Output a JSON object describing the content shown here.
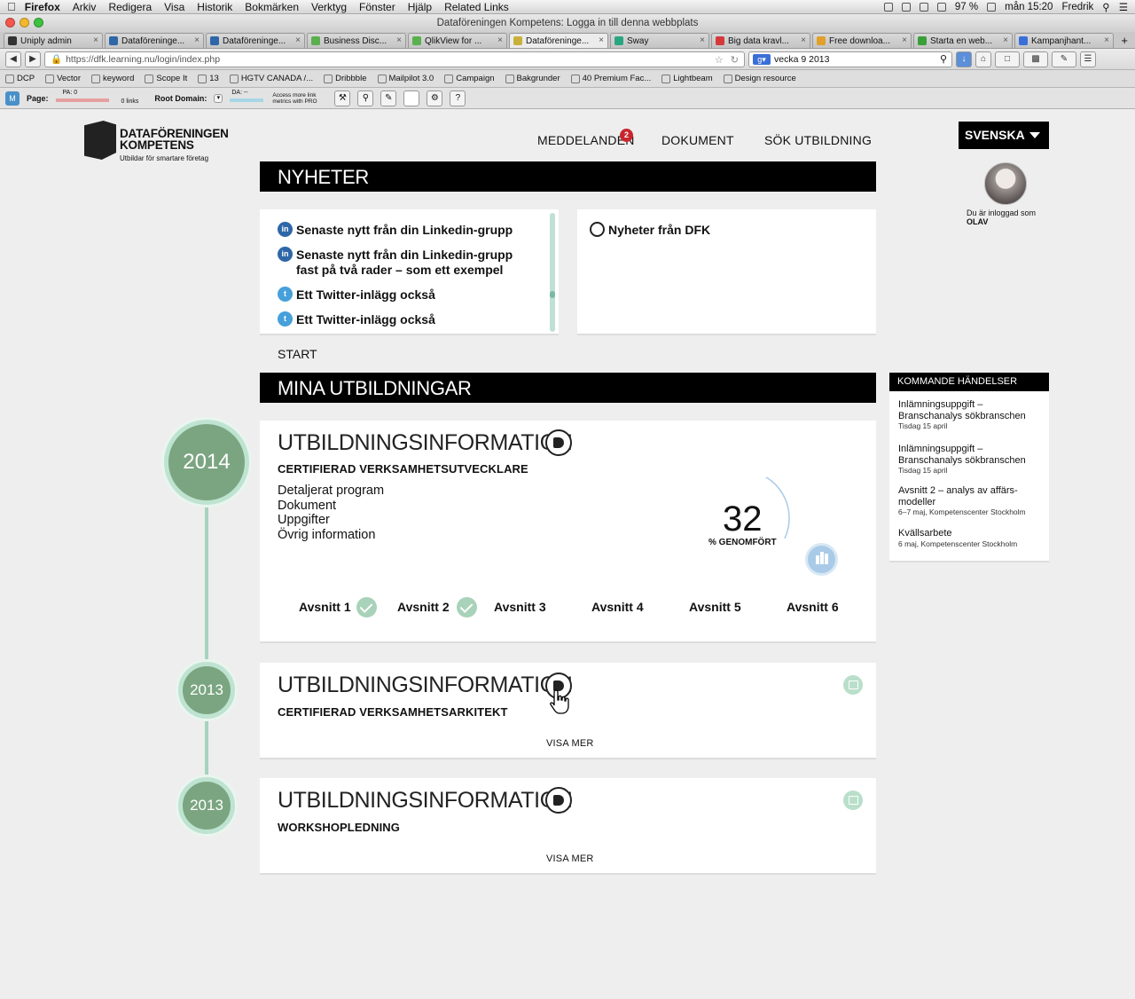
{
  "os_menu": {
    "app": "Firefox",
    "items": [
      "Arkiv",
      "Redigera",
      "Visa",
      "Historik",
      "Bokmärken",
      "Verktyg",
      "Fönster",
      "Hjälp",
      "Related Links"
    ],
    "battery": "97 %",
    "clock": "mån 15:20",
    "user": "Fredrik"
  },
  "window_title": "Dataföreningen Kompetens: Logga in till denna webbplats",
  "tabs": [
    {
      "label": "Uniply admin",
      "color": "#333"
    },
    {
      "label": "Dataföreninge...",
      "color": "#2e67a8"
    },
    {
      "label": "Dataföreninge...",
      "color": "#2e67a8"
    },
    {
      "label": "Business Disc...",
      "color": "#5ab04e"
    },
    {
      "label": "QlikView for ...",
      "color": "#5ab04e"
    },
    {
      "label": "Dataföreninge...",
      "color": "#c9b03a",
      "active": true
    },
    {
      "label": "Sway",
      "color": "#29a67f"
    },
    {
      "label": "Big data kravl...",
      "color": "#d43a3a"
    },
    {
      "label": "Free downloa...",
      "color": "#e0a02a"
    },
    {
      "label": "Starta en web...",
      "color": "#3a9e3a"
    },
    {
      "label": "Kampanjhant...",
      "color": "#3a6fd8"
    }
  ],
  "urlbar": {
    "url": "https://dfk.learning.nu/login/index.php",
    "search_value": "vecka 9 2013"
  },
  "bookmarks": [
    "DCP",
    "Vector",
    "keyword",
    "Scope It",
    "13",
    "HGTV CANADA /...",
    "Dribbble",
    "Mailpilot 3.0",
    "Campaign",
    "Bakgrunder",
    "40 Premium Fac...",
    "Lightbeam",
    "Design resource"
  ],
  "seo": {
    "page_label": "Page:",
    "pa": "PA: 0",
    "links": "0 links",
    "root_label": "Root Domain:",
    "da": "DA: --",
    "pro": "Access more link metrics with PRO"
  },
  "logo": {
    "line1": "DATAFÖRENINGEN",
    "line2": "KOMPETENS",
    "tagline": "Utbildar för smartare företag"
  },
  "nav": {
    "messages": "MEDDELANDEN",
    "messages_count": "2",
    "documents": "DOKUMENT",
    "search": "SÖK UTBILDNING"
  },
  "language": "SVENSKA",
  "user": {
    "logged_in_label": "Du är inloggad som",
    "name": "OLAV"
  },
  "news": {
    "header": "NYHETER",
    "items": [
      "Senaste nytt från din Linkedin-grupp",
      "Senaste nytt från din Linkedin-grupp fast på två rader – som ett exempel",
      "Ett Twitter-inlägg också",
      "Ett Twitter-inlägg också"
    ],
    "dfk_title": "Nyheter från DFK"
  },
  "breadcrumb": "START",
  "courses_header": "MINA UTBILDNINGAR",
  "courses": [
    {
      "year": "2014",
      "title": "UTBILDNINGSINFORMATION",
      "program": "CERTIFIERAD VERKSAMHETSUTVECKLARE",
      "links": [
        "Detaljerat program",
        "Dokument",
        "Uppgifter",
        "Övrig information"
      ],
      "progress": "32",
      "progress_label": "% GENOMFÖRT",
      "sections": [
        "Avsnitt 1",
        "Avsnitt 2",
        "Avsnitt 3",
        "Avsnitt 4",
        "Avsnitt 5",
        "Avsnitt 6"
      ]
    },
    {
      "year": "2013",
      "title": "UTBILDNINGSINFORMATION",
      "program": "CERTIFIERAD VERKSAMHETSARKITEKT",
      "more": "VISA MER"
    },
    {
      "year": "2013",
      "title": "UTBILDNINGSINFORMATION",
      "program": "WORKSHOPLEDNING",
      "more": "VISA MER"
    }
  ],
  "events": {
    "header": "KOMMANDE HÄNDELSER",
    "items": [
      {
        "title": "Inlämningsuppgift – Branschanalys sökbranschen",
        "when": "Tisdag 15 april"
      },
      {
        "title": "Inlämningsuppgift – Branschanalys sökbranschen",
        "when": "Tisdag 15 april"
      },
      {
        "title": "Avsnitt 2 – analys av affärs-modeller",
        "when": "6–7 maj, Kompetenscenter Stockholm"
      },
      {
        "title": "Kvällsarbete",
        "when": "6 maj, Kompetenscenter Stockholm"
      }
    ]
  },
  "colors": {
    "accent_green": "#7ba581",
    "light_green": "#a6d3bf",
    "progress_blue": "#a9cbe8",
    "badge_red": "#c8262e"
  }
}
